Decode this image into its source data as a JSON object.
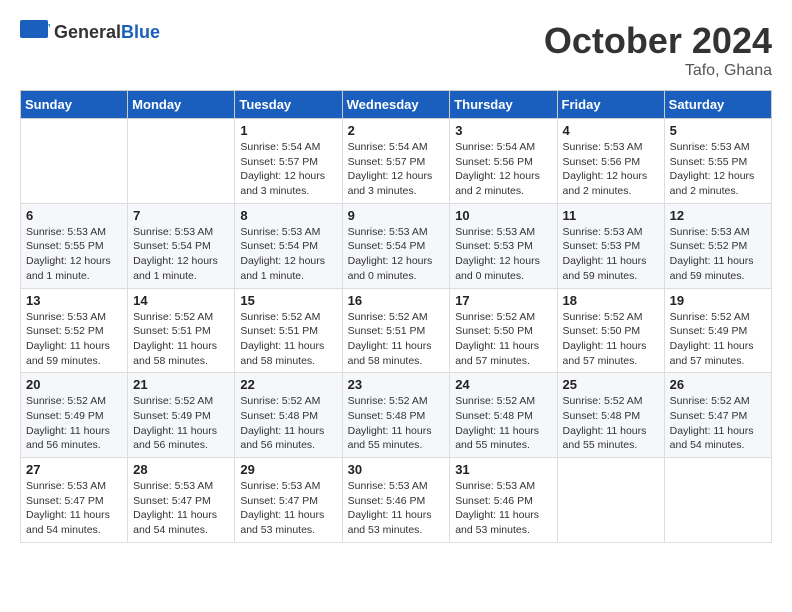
{
  "logo": {
    "general": "General",
    "blue": "Blue"
  },
  "header": {
    "month": "October 2024",
    "location": "Tafo, Ghana"
  },
  "weekdays": [
    "Sunday",
    "Monday",
    "Tuesday",
    "Wednesday",
    "Thursday",
    "Friday",
    "Saturday"
  ],
  "weeks": [
    [
      {
        "day": "",
        "info": ""
      },
      {
        "day": "",
        "info": ""
      },
      {
        "day": "1",
        "info": "Sunrise: 5:54 AM\nSunset: 5:57 PM\nDaylight: 12 hours and 3 minutes."
      },
      {
        "day": "2",
        "info": "Sunrise: 5:54 AM\nSunset: 5:57 PM\nDaylight: 12 hours and 3 minutes."
      },
      {
        "day": "3",
        "info": "Sunrise: 5:54 AM\nSunset: 5:56 PM\nDaylight: 12 hours and 2 minutes."
      },
      {
        "day": "4",
        "info": "Sunrise: 5:53 AM\nSunset: 5:56 PM\nDaylight: 12 hours and 2 minutes."
      },
      {
        "day": "5",
        "info": "Sunrise: 5:53 AM\nSunset: 5:55 PM\nDaylight: 12 hours and 2 minutes."
      }
    ],
    [
      {
        "day": "6",
        "info": "Sunrise: 5:53 AM\nSunset: 5:55 PM\nDaylight: 12 hours and 1 minute."
      },
      {
        "day": "7",
        "info": "Sunrise: 5:53 AM\nSunset: 5:54 PM\nDaylight: 12 hours and 1 minute."
      },
      {
        "day": "8",
        "info": "Sunrise: 5:53 AM\nSunset: 5:54 PM\nDaylight: 12 hours and 1 minute."
      },
      {
        "day": "9",
        "info": "Sunrise: 5:53 AM\nSunset: 5:54 PM\nDaylight: 12 hours and 0 minutes."
      },
      {
        "day": "10",
        "info": "Sunrise: 5:53 AM\nSunset: 5:53 PM\nDaylight: 12 hours and 0 minutes."
      },
      {
        "day": "11",
        "info": "Sunrise: 5:53 AM\nSunset: 5:53 PM\nDaylight: 11 hours and 59 minutes."
      },
      {
        "day": "12",
        "info": "Sunrise: 5:53 AM\nSunset: 5:52 PM\nDaylight: 11 hours and 59 minutes."
      }
    ],
    [
      {
        "day": "13",
        "info": "Sunrise: 5:53 AM\nSunset: 5:52 PM\nDaylight: 11 hours and 59 minutes."
      },
      {
        "day": "14",
        "info": "Sunrise: 5:52 AM\nSunset: 5:51 PM\nDaylight: 11 hours and 58 minutes."
      },
      {
        "day": "15",
        "info": "Sunrise: 5:52 AM\nSunset: 5:51 PM\nDaylight: 11 hours and 58 minutes."
      },
      {
        "day": "16",
        "info": "Sunrise: 5:52 AM\nSunset: 5:51 PM\nDaylight: 11 hours and 58 minutes."
      },
      {
        "day": "17",
        "info": "Sunrise: 5:52 AM\nSunset: 5:50 PM\nDaylight: 11 hours and 57 minutes."
      },
      {
        "day": "18",
        "info": "Sunrise: 5:52 AM\nSunset: 5:50 PM\nDaylight: 11 hours and 57 minutes."
      },
      {
        "day": "19",
        "info": "Sunrise: 5:52 AM\nSunset: 5:49 PM\nDaylight: 11 hours and 57 minutes."
      }
    ],
    [
      {
        "day": "20",
        "info": "Sunrise: 5:52 AM\nSunset: 5:49 PM\nDaylight: 11 hours and 56 minutes."
      },
      {
        "day": "21",
        "info": "Sunrise: 5:52 AM\nSunset: 5:49 PM\nDaylight: 11 hours and 56 minutes."
      },
      {
        "day": "22",
        "info": "Sunrise: 5:52 AM\nSunset: 5:48 PM\nDaylight: 11 hours and 56 minutes."
      },
      {
        "day": "23",
        "info": "Sunrise: 5:52 AM\nSunset: 5:48 PM\nDaylight: 11 hours and 55 minutes."
      },
      {
        "day": "24",
        "info": "Sunrise: 5:52 AM\nSunset: 5:48 PM\nDaylight: 11 hours and 55 minutes."
      },
      {
        "day": "25",
        "info": "Sunrise: 5:52 AM\nSunset: 5:48 PM\nDaylight: 11 hours and 55 minutes."
      },
      {
        "day": "26",
        "info": "Sunrise: 5:52 AM\nSunset: 5:47 PM\nDaylight: 11 hours and 54 minutes."
      }
    ],
    [
      {
        "day": "27",
        "info": "Sunrise: 5:53 AM\nSunset: 5:47 PM\nDaylight: 11 hours and 54 minutes."
      },
      {
        "day": "28",
        "info": "Sunrise: 5:53 AM\nSunset: 5:47 PM\nDaylight: 11 hours and 54 minutes."
      },
      {
        "day": "29",
        "info": "Sunrise: 5:53 AM\nSunset: 5:47 PM\nDaylight: 11 hours and 53 minutes."
      },
      {
        "day": "30",
        "info": "Sunrise: 5:53 AM\nSunset: 5:46 PM\nDaylight: 11 hours and 53 minutes."
      },
      {
        "day": "31",
        "info": "Sunrise: 5:53 AM\nSunset: 5:46 PM\nDaylight: 11 hours and 53 minutes."
      },
      {
        "day": "",
        "info": ""
      },
      {
        "day": "",
        "info": ""
      }
    ]
  ]
}
